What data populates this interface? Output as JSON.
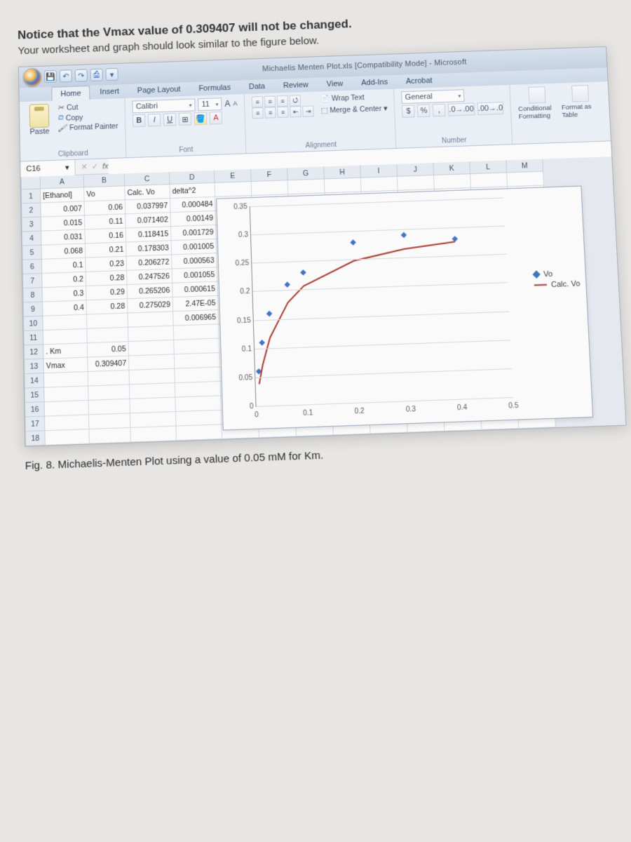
{
  "instruction_line1": "Notice that the Vmax value of 0.309407 will not be changed.",
  "instruction_line2": "Your worksheet and graph should look similar to the figure below.",
  "caption": "Fig. 8. Michaelis-Menten Plot using a value of 0.05 mM for Km.",
  "window_title": "Michaelis Menten Plot.xls [Compatibility Mode] - Microsoft",
  "tabs": [
    "Home",
    "Insert",
    "Page Layout",
    "Formulas",
    "Data",
    "Review",
    "View",
    "Add-Ins",
    "Acrobat"
  ],
  "clipboard": {
    "paste": "Paste",
    "cut": "Cut",
    "copy": "Copy",
    "format_painter": "Format Painter",
    "title": "Clipboard"
  },
  "font": {
    "name": "Calibri",
    "size": "11",
    "title": "Font"
  },
  "alignment": {
    "wrap": "Wrap Text",
    "merge": "Merge & Center",
    "title": "Alignment"
  },
  "number": {
    "format": "General",
    "title": "Number"
  },
  "styles": {
    "cond": "Conditional Formatting",
    "astable": "Format as Table"
  },
  "namebox": "C16",
  "columns": [
    "A",
    "B",
    "C",
    "D",
    "E",
    "F",
    "G",
    "H",
    "I",
    "J",
    "K",
    "L",
    "M"
  ],
  "headers": {
    "A": "[Ethanol]",
    "B": "Vo",
    "C": "Calc. Vo",
    "D": "delta^2"
  },
  "table": [
    {
      "A": "0.007",
      "B": "0.06",
      "C": "0.037997",
      "D": "0.000484"
    },
    {
      "A": "0.015",
      "B": "0.11",
      "C": "0.071402",
      "D": "0.00149"
    },
    {
      "A": "0.031",
      "B": "0.16",
      "C": "0.118415",
      "D": "0.001729"
    },
    {
      "A": "0.068",
      "B": "0.21",
      "C": "0.178303",
      "D": "0.001005"
    },
    {
      "A": "0.1",
      "B": "0.23",
      "C": "0.206272",
      "D": "0.000563"
    },
    {
      "A": "0.2",
      "B": "0.28",
      "C": "0.247526",
      "D": "0.001055"
    },
    {
      "A": "0.3",
      "B": "0.29",
      "C": "0.265206",
      "D": "0.000615"
    },
    {
      "A": "0.4",
      "B": "0.28",
      "C": "0.275029",
      "D": "2.47E-05"
    }
  ],
  "sum_delta": "0.006965",
  "km_label": ". Km",
  "km_value": "0.05",
  "vmax_label": "Vmax",
  "vmax_value": "0.309407",
  "legend": {
    "vo": "Vo",
    "calcvo": "Calc. Vo"
  },
  "chart_data": {
    "type": "scatter+line",
    "xlabel": "",
    "ylabel": "",
    "xlim": [
      0,
      0.5
    ],
    "ylim": [
      0,
      0.35
    ],
    "xticks": [
      0,
      0.1,
      0.2,
      0.3,
      0.4,
      0.5
    ],
    "yticks": [
      0,
      0.05,
      0.1,
      0.15,
      0.2,
      0.25,
      0.3,
      0.35
    ],
    "series": [
      {
        "name": "Vo",
        "type": "scatter",
        "x": [
          0.007,
          0.015,
          0.031,
          0.068,
          0.1,
          0.2,
          0.3,
          0.4
        ],
        "y": [
          0.06,
          0.11,
          0.16,
          0.21,
          0.23,
          0.28,
          0.29,
          0.28
        ]
      },
      {
        "name": "Calc. Vo",
        "type": "line",
        "x": [
          0.007,
          0.015,
          0.031,
          0.068,
          0.1,
          0.2,
          0.3,
          0.4
        ],
        "y": [
          0.037997,
          0.071402,
          0.118415,
          0.178303,
          0.206272,
          0.247526,
          0.265206,
          0.275029
        ]
      }
    ]
  }
}
